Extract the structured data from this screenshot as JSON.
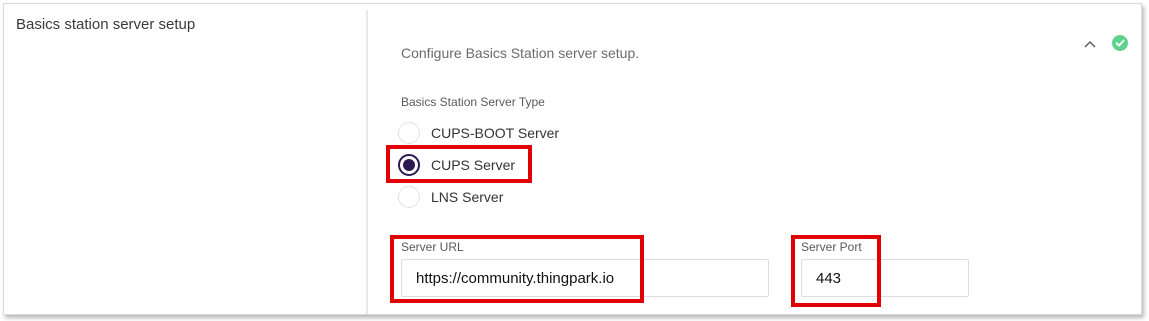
{
  "section": {
    "title": "Basics station server setup",
    "description": "Configure Basics Station server setup."
  },
  "icons": {
    "collapse": "chevron-up-icon",
    "status": "check-circle-icon",
    "status_color": "#5fd38d"
  },
  "server_type": {
    "label": "Basics Station Server Type",
    "options": [
      {
        "label": "CUPS-BOOT Server",
        "selected": false
      },
      {
        "label": "CUPS Server",
        "selected": true
      },
      {
        "label": "LNS Server",
        "selected": false
      }
    ]
  },
  "server_url": {
    "label": "Server URL",
    "value": "https://community.thingpark.io"
  },
  "server_port": {
    "label": "Server Port",
    "value": "443"
  },
  "colors": {
    "accent": "#2b1a52",
    "highlight": "#e00000"
  }
}
